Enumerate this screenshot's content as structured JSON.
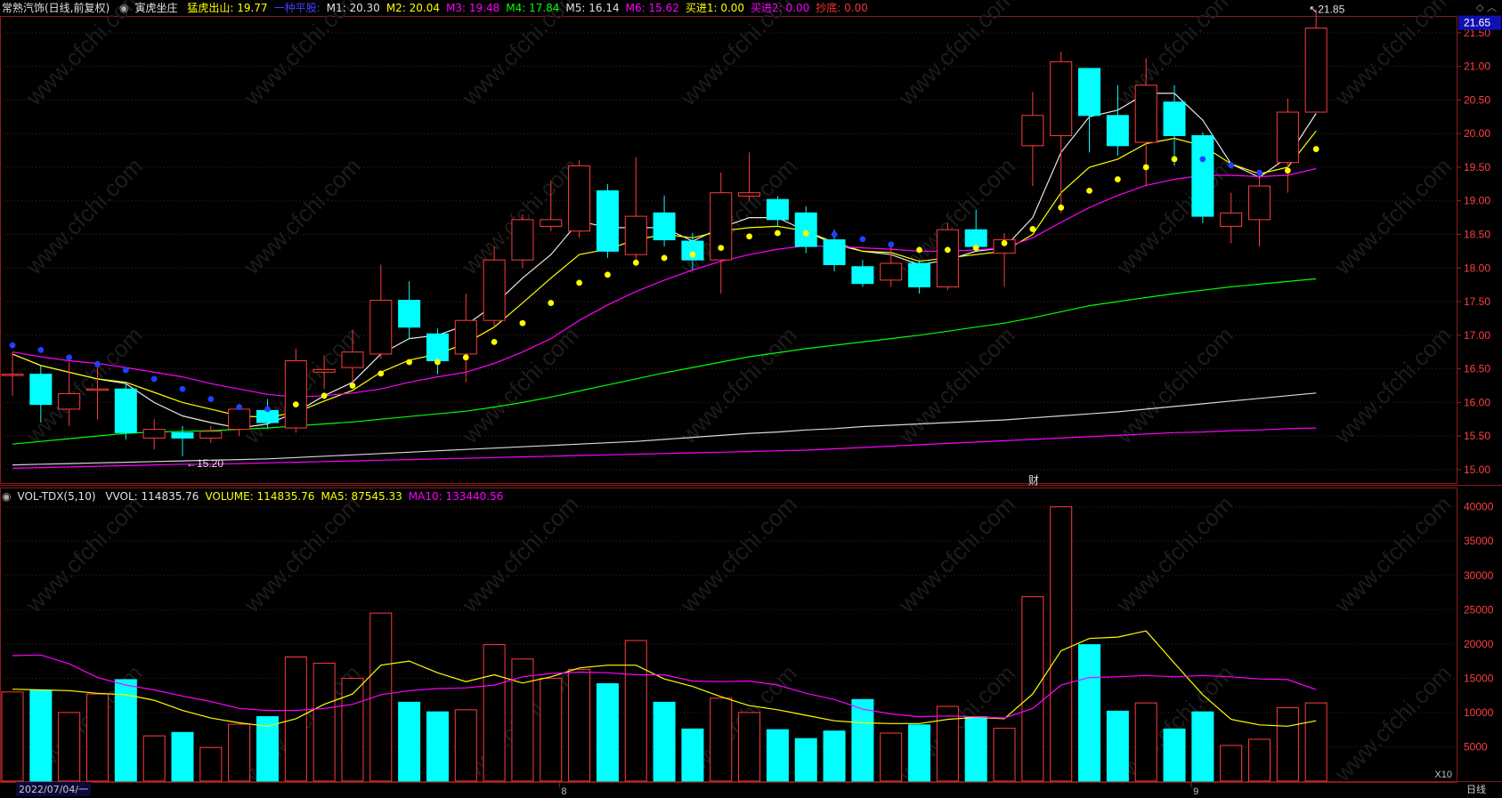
{
  "header": {
    "stock": "常熟汽饰(日线,前复权)",
    "indicator_name": "寅虎坐庄",
    "items": [
      {
        "label": "猛虎出山: 19.77",
        "color": "#ffff00"
      },
      {
        "label": "一种平股:",
        "color": "#4040ff"
      },
      {
        "label": "M1: 20.30",
        "color": "#e0e0e0"
      },
      {
        "label": "M2: 20.04",
        "color": "#ffff00"
      },
      {
        "label": "M3: 19.48",
        "color": "#ff00ff"
      },
      {
        "label": "M4: 17.84",
        "color": "#00ff00"
      },
      {
        "label": "M5: 16.14",
        "color": "#e0e0e0"
      },
      {
        "label": "M6: 15.62",
        "color": "#ff00ff"
      },
      {
        "label": "买进1: 0.00",
        "color": "#ffff00"
      },
      {
        "label": "买进2: 0.00",
        "color": "#ff00ff"
      },
      {
        "label": "抄底: 0.00",
        "color": "#ff3030"
      }
    ]
  },
  "volume_header": {
    "name": "VOL-TDX(5,10)",
    "items": [
      {
        "label": "VVOL: 114835.76",
        "color": "#e0e0e0"
      },
      {
        "label": "VOLUME: 114835.76",
        "color": "#ffff00"
      },
      {
        "label": "MA5: 87545.33",
        "color": "#ffff00"
      },
      {
        "label": "MA10: 133440.56",
        "color": "#ff00ff"
      }
    ]
  },
  "footer": {
    "start_date": "2022/07/04/一",
    "month_8": "8",
    "month_9": "9",
    "timeframe": "日线",
    "ratio": "X10"
  },
  "chart_data": {
    "type": "candlestick",
    "price_axis": {
      "min": 14.8,
      "max": 21.75,
      "ticks": [
        "21.50",
        "21.00",
        "20.50",
        "20.00",
        "19.50",
        "19.00",
        "18.50",
        "18.00",
        "17.50",
        "17.00",
        "16.50",
        "16.00",
        "15.50",
        "15.00"
      ],
      "current": "21.65"
    },
    "annotations": {
      "high": "21.85",
      "low": "15.20",
      "event": "财"
    },
    "volume_axis": {
      "min": 0,
      "max": 41000,
      "ticks": [
        "40000",
        "35000",
        "30000",
        "25000",
        "20000",
        "15000",
        "10000",
        "5000"
      ]
    },
    "candles": [
      {
        "o": 16.42,
        "c": 16.42,
        "h": 16.75,
        "l": 16.1
      },
      {
        "o": 16.42,
        "c": 15.97,
        "h": 16.55,
        "l": 15.7
      },
      {
        "o": 15.9,
        "c": 16.13,
        "h": 16.6,
        "l": 15.65
      },
      {
        "o": 16.2,
        "c": 16.2,
        "h": 16.6,
        "l": 15.75
      },
      {
        "o": 16.2,
        "c": 15.55,
        "h": 16.3,
        "l": 15.45
      },
      {
        "o": 15.47,
        "c": 15.6,
        "h": 15.75,
        "l": 15.3
      },
      {
        "o": 15.55,
        "c": 15.47,
        "h": 15.65,
        "l": 15.2
      },
      {
        "o": 15.47,
        "c": 15.57,
        "h": 15.65,
        "l": 15.4
      },
      {
        "o": 15.6,
        "c": 15.9,
        "h": 15.98,
        "l": 15.5
      },
      {
        "o": 15.88,
        "c": 15.7,
        "h": 16.05,
        "l": 15.62
      },
      {
        "o": 15.62,
        "c": 16.62,
        "h": 16.8,
        "l": 15.55
      },
      {
        "o": 16.45,
        "c": 16.49,
        "h": 16.7,
        "l": 16.2
      },
      {
        "o": 16.52,
        "c": 16.75,
        "h": 17.08,
        "l": 16.28
      },
      {
        "o": 16.72,
        "c": 17.52,
        "h": 18.05,
        "l": 16.65
      },
      {
        "o": 17.52,
        "c": 17.12,
        "h": 17.8,
        "l": 16.95
      },
      {
        "o": 17.02,
        "c": 16.62,
        "h": 17.1,
        "l": 16.42
      },
      {
        "o": 16.72,
        "c": 17.22,
        "h": 17.62,
        "l": 16.3
      },
      {
        "o": 17.22,
        "c": 18.12,
        "h": 18.32,
        "l": 17.12
      },
      {
        "o": 18.12,
        "c": 18.72,
        "h": 18.8,
        "l": 18.0
      },
      {
        "o": 18.62,
        "c": 18.72,
        "h": 19.3,
        "l": 18.55
      },
      {
        "o": 18.55,
        "c": 19.52,
        "h": 19.6,
        "l": 18.45
      },
      {
        "o": 19.15,
        "c": 18.25,
        "h": 19.25,
        "l": 18.15
      },
      {
        "o": 18.2,
        "c": 18.77,
        "h": 19.65,
        "l": 18.1
      },
      {
        "o": 18.82,
        "c": 18.42,
        "h": 19.08,
        "l": 18.32
      },
      {
        "o": 18.4,
        "c": 18.12,
        "h": 18.52,
        "l": 17.98
      },
      {
        "o": 18.12,
        "c": 19.12,
        "h": 19.42,
        "l": 17.62
      },
      {
        "o": 19.07,
        "c": 19.12,
        "h": 19.72,
        "l": 19.0
      },
      {
        "o": 19.02,
        "c": 18.72,
        "h": 19.07,
        "l": 18.62
      },
      {
        "o": 18.82,
        "c": 18.32,
        "h": 18.92,
        "l": 18.22
      },
      {
        "o": 18.42,
        "c": 18.05,
        "h": 18.57,
        "l": 17.95
      },
      {
        "o": 18.02,
        "c": 17.77,
        "h": 18.12,
        "l": 17.72
      },
      {
        "o": 17.82,
        "c": 18.07,
        "h": 18.37,
        "l": 17.72
      },
      {
        "o": 18.07,
        "c": 17.72,
        "h": 18.12,
        "l": 17.62
      },
      {
        "o": 17.72,
        "c": 18.57,
        "h": 18.67,
        "l": 17.67
      },
      {
        "o": 18.57,
        "c": 18.32,
        "h": 18.87,
        "l": 18.27
      },
      {
        "o": 18.22,
        "c": 18.42,
        "h": 18.52,
        "l": 17.72
      },
      {
        "o": 19.82,
        "c": 20.27,
        "h": 20.62,
        "l": 19.22
      },
      {
        "o": 19.97,
        "c": 21.07,
        "h": 21.22,
        "l": 18.82
      },
      {
        "o": 20.97,
        "c": 20.27,
        "h": 20.97,
        "l": 19.72
      },
      {
        "o": 20.27,
        "c": 19.82,
        "h": 20.72,
        "l": 19.67
      },
      {
        "o": 19.87,
        "c": 20.72,
        "h": 21.12,
        "l": 19.22
      },
      {
        "o": 20.47,
        "c": 19.97,
        "h": 20.72,
        "l": 19.52
      },
      {
        "o": 19.97,
        "c": 18.77,
        "h": 20.02,
        "l": 18.67
      },
      {
        "o": 18.62,
        "c": 18.82,
        "h": 19.12,
        "l": 18.37
      },
      {
        "o": 18.72,
        "c": 19.22,
        "h": 19.42,
        "l": 18.32
      },
      {
        "o": 19.57,
        "c": 20.32,
        "h": 20.52,
        "l": 19.12
      },
      {
        "o": 20.32,
        "c": 21.57,
        "h": 21.85,
        "l": 20.32
      }
    ],
    "volume": [
      13000,
      13200,
      10000,
      12700,
      14800,
      6600,
      7100,
      4900,
      8300,
      9400,
      18100,
      17200,
      15000,
      24500,
      11500,
      10100,
      10400,
      19900,
      17800,
      15000,
      16300,
      14200,
      20500,
      11500,
      7600,
      12100,
      10000,
      7500,
      6200,
      7300,
      11900,
      7000,
      8200,
      10900,
      9400,
      7700,
      26900,
      40000,
      19900,
      10200,
      11400,
      7600,
      10100,
      5200,
      6100,
      10700,
      11400
    ],
    "dots": [
      {
        "i": 0,
        "v": 16.85,
        "c": "blue"
      },
      {
        "i": 1,
        "v": 16.78,
        "c": "blue"
      },
      {
        "i": 2,
        "v": 16.67,
        "c": "blue"
      },
      {
        "i": 3,
        "v": 16.57,
        "c": "blue"
      },
      {
        "i": 4,
        "v": 16.48,
        "c": "blue"
      },
      {
        "i": 5,
        "v": 16.35,
        "c": "blue"
      },
      {
        "i": 6,
        "v": 16.2,
        "c": "blue"
      },
      {
        "i": 7,
        "v": 16.05,
        "c": "blue"
      },
      {
        "i": 8,
        "v": 15.93,
        "c": "blue"
      },
      {
        "i": 9,
        "v": 15.9,
        "c": "blue"
      },
      {
        "i": 10,
        "v": 15.97,
        "c": "yellow"
      },
      {
        "i": 11,
        "v": 16.1,
        "c": "yellow"
      },
      {
        "i": 12,
        "v": 16.25,
        "c": "yellow"
      },
      {
        "i": 13,
        "v": 16.43,
        "c": "yellow"
      },
      {
        "i": 14,
        "v": 16.6,
        "c": "yellow"
      },
      {
        "i": 15,
        "v": 16.6,
        "c": "yellow"
      },
      {
        "i": 16,
        "v": 16.67,
        "c": "yellow"
      },
      {
        "i": 17,
        "v": 16.9,
        "c": "yellow"
      },
      {
        "i": 18,
        "v": 17.18,
        "c": "yellow"
      },
      {
        "i": 19,
        "v": 17.48,
        "c": "yellow"
      },
      {
        "i": 20,
        "v": 17.78,
        "c": "yellow"
      },
      {
        "i": 21,
        "v": 17.9,
        "c": "yellow"
      },
      {
        "i": 22,
        "v": 18.08,
        "c": "yellow"
      },
      {
        "i": 23,
        "v": 18.15,
        "c": "yellow"
      },
      {
        "i": 24,
        "v": 18.2,
        "c": "yellow"
      },
      {
        "i": 25,
        "v": 18.3,
        "c": "yellow"
      },
      {
        "i": 26,
        "v": 18.47,
        "c": "yellow"
      },
      {
        "i": 27,
        "v": 18.52,
        "c": "yellow"
      },
      {
        "i": 28,
        "v": 18.52,
        "c": "yellow"
      },
      {
        "i": 29,
        "v": 18.5,
        "c": "blue"
      },
      {
        "i": 30,
        "v": 18.43,
        "c": "blue"
      },
      {
        "i": 31,
        "v": 18.35,
        "c": "blue"
      },
      {
        "i": 32,
        "v": 18.27,
        "c": "yellow"
      },
      {
        "i": 33,
        "v": 18.27,
        "c": "yellow"
      },
      {
        "i": 34,
        "v": 18.3,
        "c": "yellow"
      },
      {
        "i": 35,
        "v": 18.37,
        "c": "yellow"
      },
      {
        "i": 36,
        "v": 18.58,
        "c": "yellow"
      },
      {
        "i": 37,
        "v": 18.9,
        "c": "yellow"
      },
      {
        "i": 38,
        "v": 19.15,
        "c": "yellow"
      },
      {
        "i": 39,
        "v": 19.32,
        "c": "yellow"
      },
      {
        "i": 40,
        "v": 19.5,
        "c": "yellow"
      },
      {
        "i": 41,
        "v": 19.62,
        "c": "yellow"
      },
      {
        "i": 42,
        "v": 19.62,
        "c": "blue"
      },
      {
        "i": 43,
        "v": 19.53,
        "c": "blue"
      },
      {
        "i": 44,
        "v": 19.42,
        "c": "blue"
      },
      {
        "i": 45,
        "v": 19.45,
        "c": "yellow"
      },
      {
        "i": 46,
        "v": 19.77,
        "c": "yellow"
      }
    ],
    "ma_lines": [
      {
        "name": "M1",
        "color": "#e8e8e8",
        "values": [
          16.72,
          16.55,
          16.45,
          16.35,
          16.28,
          16.0,
          15.8,
          15.7,
          15.62,
          15.68,
          15.85,
          16.1,
          16.3,
          16.72,
          16.95,
          17.0,
          17.15,
          17.45,
          17.85,
          18.2,
          18.7,
          18.6,
          18.6,
          18.6,
          18.4,
          18.6,
          18.75,
          18.75,
          18.55,
          18.35,
          18.25,
          18.2,
          18.05,
          18.12,
          18.25,
          18.3,
          18.75,
          19.72,
          20.25,
          20.35,
          20.6,
          20.6,
          20.2,
          19.55,
          19.35,
          19.65,
          20.3
        ]
      },
      {
        "name": "M2",
        "color": "#ffff00",
        "values": [
          16.72,
          16.55,
          16.45,
          16.35,
          16.3,
          16.15,
          16.0,
          15.9,
          15.8,
          15.78,
          15.85,
          16.02,
          16.18,
          16.45,
          16.63,
          16.72,
          16.88,
          17.12,
          17.48,
          17.85,
          18.2,
          18.28,
          18.42,
          18.5,
          18.45,
          18.55,
          18.6,
          18.62,
          18.55,
          18.38,
          18.25,
          18.23,
          18.1,
          18.15,
          18.2,
          18.25,
          18.5,
          19.12,
          19.5,
          19.62,
          19.85,
          19.93,
          19.82,
          19.55,
          19.4,
          19.5,
          20.04
        ]
      },
      {
        "name": "M3",
        "color": "#ff00ff",
        "values": [
          16.75,
          16.68,
          16.62,
          16.58,
          16.52,
          16.45,
          16.38,
          16.28,
          16.2,
          16.12,
          16.08,
          16.1,
          16.14,
          16.2,
          16.3,
          16.38,
          16.45,
          16.58,
          16.75,
          16.95,
          17.22,
          17.45,
          17.65,
          17.82,
          17.97,
          18.1,
          18.2,
          18.28,
          18.33,
          18.32,
          18.3,
          18.28,
          18.25,
          18.25,
          18.27,
          18.3,
          18.45,
          18.68,
          18.9,
          19.08,
          19.23,
          19.32,
          19.38,
          19.38,
          19.36,
          19.38,
          19.48
        ]
      },
      {
        "name": "M4",
        "color": "#00ff00",
        "values": [
          15.38,
          15.42,
          15.46,
          15.5,
          15.54,
          15.56,
          15.57,
          15.58,
          15.6,
          15.62,
          15.65,
          15.68,
          15.71,
          15.75,
          15.79,
          15.83,
          15.87,
          15.93,
          16.0,
          16.08,
          16.17,
          16.26,
          16.35,
          16.44,
          16.52,
          16.6,
          16.68,
          16.74,
          16.8,
          16.85,
          16.9,
          16.95,
          17.0,
          17.06,
          17.12,
          17.18,
          17.26,
          17.35,
          17.44,
          17.5,
          17.56,
          17.62,
          17.67,
          17.72,
          17.76,
          17.8,
          17.84
        ]
      },
      {
        "name": "M5",
        "color": "#d8d8d8",
        "values": [
          15.07,
          15.08,
          15.09,
          15.1,
          15.11,
          15.12,
          15.13,
          15.14,
          15.15,
          15.16,
          15.18,
          15.2,
          15.22,
          15.24,
          15.26,
          15.28,
          15.3,
          15.32,
          15.34,
          15.36,
          15.38,
          15.4,
          15.42,
          15.45,
          15.48,
          15.51,
          15.54,
          15.56,
          15.59,
          15.61,
          15.64,
          15.66,
          15.68,
          15.7,
          15.72,
          15.74,
          15.77,
          15.8,
          15.83,
          15.86,
          15.9,
          15.94,
          15.98,
          16.02,
          16.06,
          16.1,
          16.14
        ]
      },
      {
        "name": "M6",
        "color": "#ff00ff",
        "values": [
          15.02,
          15.03,
          15.04,
          15.05,
          15.06,
          15.07,
          15.08,
          15.08,
          15.09,
          15.1,
          15.11,
          15.12,
          15.13,
          15.14,
          15.15,
          15.16,
          15.17,
          15.18,
          15.19,
          15.2,
          15.21,
          15.22,
          15.23,
          15.24,
          15.25,
          15.26,
          15.27,
          15.28,
          15.29,
          15.31,
          15.33,
          15.35,
          15.37,
          15.39,
          15.41,
          15.43,
          15.45,
          15.47,
          15.49,
          15.51,
          15.53,
          15.55,
          15.56,
          15.58,
          15.59,
          15.61,
          15.62
        ]
      }
    ],
    "volume_ma": [
      {
        "name": "MA5",
        "color": "#ffff00",
        "values": [
          13400,
          13300,
          13200,
          12800,
          12600,
          11800,
          10300,
          9200,
          8500,
          8000,
          9100,
          11200,
          12700,
          16900,
          17500,
          15800,
          14500,
          15500,
          14300,
          15200,
          16500,
          16900,
          16900,
          14900,
          13800,
          12300,
          11000,
          10400,
          9600,
          8800,
          8500,
          8400,
          8400,
          9000,
          9300,
          9100,
          12700,
          19000,
          20800,
          21000,
          21900,
          17200,
          12600,
          9000,
          8200,
          8000,
          8800
        ]
      },
      {
        "name": "MA10",
        "color": "#ff00ff",
        "values": [
          18300,
          18400,
          17100,
          15100,
          14000,
          13300,
          12400,
          11600,
          10600,
          10300,
          10300,
          10600,
          11200,
          12600,
          13200,
          13500,
          13600,
          14000,
          15200,
          15700,
          15900,
          15800,
          15500,
          15500,
          14600,
          14500,
          14600,
          14000,
          12800,
          11900,
          10500,
          9800,
          9400,
          9500,
          9400,
          9200,
          10600,
          14000,
          15100,
          15200,
          15400,
          15200,
          15400,
          15200,
          14900,
          14800,
          13344
        ]
      }
    ]
  }
}
